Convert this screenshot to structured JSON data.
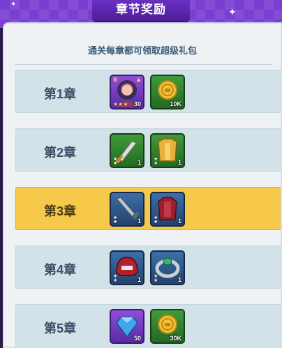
{
  "header": {
    "title": "章节奖励"
  },
  "panel": {
    "subtitle": "通关每章都可领取超级礼包"
  },
  "chapters": [
    {
      "label": "第1章",
      "active": false,
      "rewards": [
        {
          "icon": "hero-portrait-icon",
          "qty": "30",
          "frame": "purple",
          "stars": 3
        },
        {
          "icon": "gold-coin-icon",
          "qty": "10K",
          "frame": "green"
        }
      ]
    },
    {
      "label": "第2章",
      "active": false,
      "rewards": [
        {
          "icon": "sword-icon",
          "qty": "1",
          "frame": "green",
          "stars": 2
        },
        {
          "icon": "armor-icon",
          "qty": "1",
          "frame": "green",
          "stars": 2
        }
      ]
    },
    {
      "label": "第3章",
      "active": true,
      "rewards": [
        {
          "icon": "blade-icon",
          "qty": "1",
          "frame": "blue",
          "stars": 2
        },
        {
          "icon": "red-armor-icon",
          "qty": "1",
          "frame": "blue",
          "stars": 2
        }
      ]
    },
    {
      "label": "第4章",
      "active": false,
      "rewards": [
        {
          "icon": "helmet-icon",
          "qty": "1",
          "frame": "blue",
          "stars": 2
        },
        {
          "icon": "ring-icon",
          "qty": "1",
          "frame": "blue",
          "stars": 2
        }
      ]
    },
    {
      "label": "第5章",
      "active": false,
      "rewards": [
        {
          "icon": "diamond-icon",
          "qty": "50",
          "frame": "purple"
        },
        {
          "icon": "gold-coin-icon",
          "qty": "30K",
          "frame": "green"
        }
      ]
    }
  ],
  "colors": {
    "active_row": "#f6c94a",
    "inactive_row": "#d3e2e8",
    "header_purple": "#7a3fd0"
  }
}
